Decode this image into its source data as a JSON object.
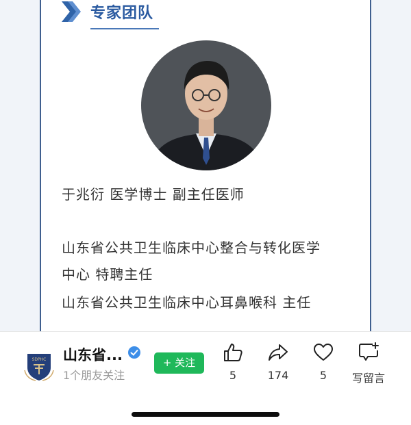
{
  "section": {
    "title": "专家团队",
    "icon": "chevron-right-icon"
  },
  "profile": {
    "name_line": "于兆衍 医学博士 副主任医师",
    "role1_part1": "山东省公共卫生临床中心整合与转化医学",
    "role1_part2": "中心 特聘主任",
    "role2": "山东省公共卫生临床中心耳鼻喉科 主任"
  },
  "account": {
    "name": "山东省...",
    "friends_following": "1个朋友关注",
    "follow_label": "+ 关注"
  },
  "actions": {
    "like_count": "5",
    "share_count": "174",
    "favorite_count": "5",
    "comment_label": "写留言"
  },
  "colors": {
    "accent_blue": "#2a5aa0",
    "follow_green": "#1fb85a",
    "card_border": "#3f5f8f"
  }
}
